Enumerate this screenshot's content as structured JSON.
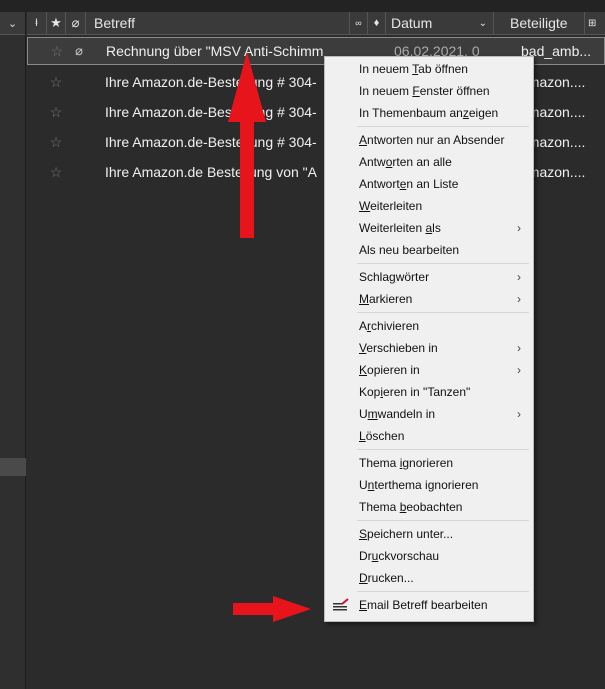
{
  "header": {
    "columns": {
      "subject": "Betreff",
      "date": "Datum",
      "participants": "Beteiligte"
    }
  },
  "messages": [
    {
      "subject": "Rechnung über \"MSV Anti-Schimm",
      "date": "06.02.2021, 0",
      "participants": "bad_amb...",
      "attachment": true,
      "selected": true
    },
    {
      "subject": "Ihre Amazon.de-Bestellung # 304-",
      "date": "",
      "participants": "amazon....",
      "attachment": false
    },
    {
      "subject": "Ihre Amazon.de-Bestellung # 304-",
      "date": "",
      "participants": "amazon....",
      "attachment": false
    },
    {
      "subject": "Ihre Amazon.de-Bestellung # 304-",
      "date": "",
      "participants": "amazon....",
      "attachment": false
    },
    {
      "subject": "Ihre Amazon.de Bestellung von \"A",
      "date": "",
      "participants": "amazon....",
      "attachment": false
    }
  ],
  "context_menu": {
    "groups": [
      [
        {
          "label": "In neuem Tab öffnen",
          "key": "T"
        },
        {
          "label": "In neuem Fenster öffnen",
          "key": "F"
        },
        {
          "label": "In Themenbaum anzeigen",
          "key": "z"
        }
      ],
      [
        {
          "label": "Antworten nur an Absender",
          "key": "A"
        },
        {
          "label": "Antworten an alle",
          "key": "o"
        },
        {
          "label": "Antworten an Liste",
          "key": "e"
        },
        {
          "label": "Weiterleiten",
          "key": "W"
        },
        {
          "label": "Weiterleiten als",
          "key": "a",
          "submenu": true
        },
        {
          "label": "Als neu bearbeiten",
          "key": ""
        }
      ],
      [
        {
          "label": "Schlagwörter",
          "key": "g",
          "submenu": true
        },
        {
          "label": "Markieren",
          "key": "M",
          "submenu": true
        }
      ],
      [
        {
          "label": "Archivieren",
          "key": "r"
        },
        {
          "label": "Verschieben in",
          "key": "V",
          "submenu": true
        },
        {
          "label": "Kopieren in",
          "key": "K",
          "submenu": true
        },
        {
          "label": "Kopieren in \"Tanzen\"",
          "key": "i"
        },
        {
          "label": "Umwandeln in",
          "key": "m",
          "submenu": true
        },
        {
          "label": "Löschen",
          "key": "L"
        }
      ],
      [
        {
          "label": "Thema ignorieren",
          "key": "i"
        },
        {
          "label": "Unterthema ignorieren",
          "key": "n"
        },
        {
          "label": "Thema beobachten",
          "key": "b"
        }
      ],
      [
        {
          "label": "Speichern unter...",
          "key": "S"
        },
        {
          "label": "Druckvorschau",
          "key": "u"
        },
        {
          "label": "Drucken...",
          "key": "D"
        }
      ],
      [
        {
          "label": "Email Betreff bearbeiten",
          "key": "E",
          "icon": "edit-subject-icon"
        }
      ]
    ]
  },
  "colors": {
    "arrow": "#e8141c"
  }
}
